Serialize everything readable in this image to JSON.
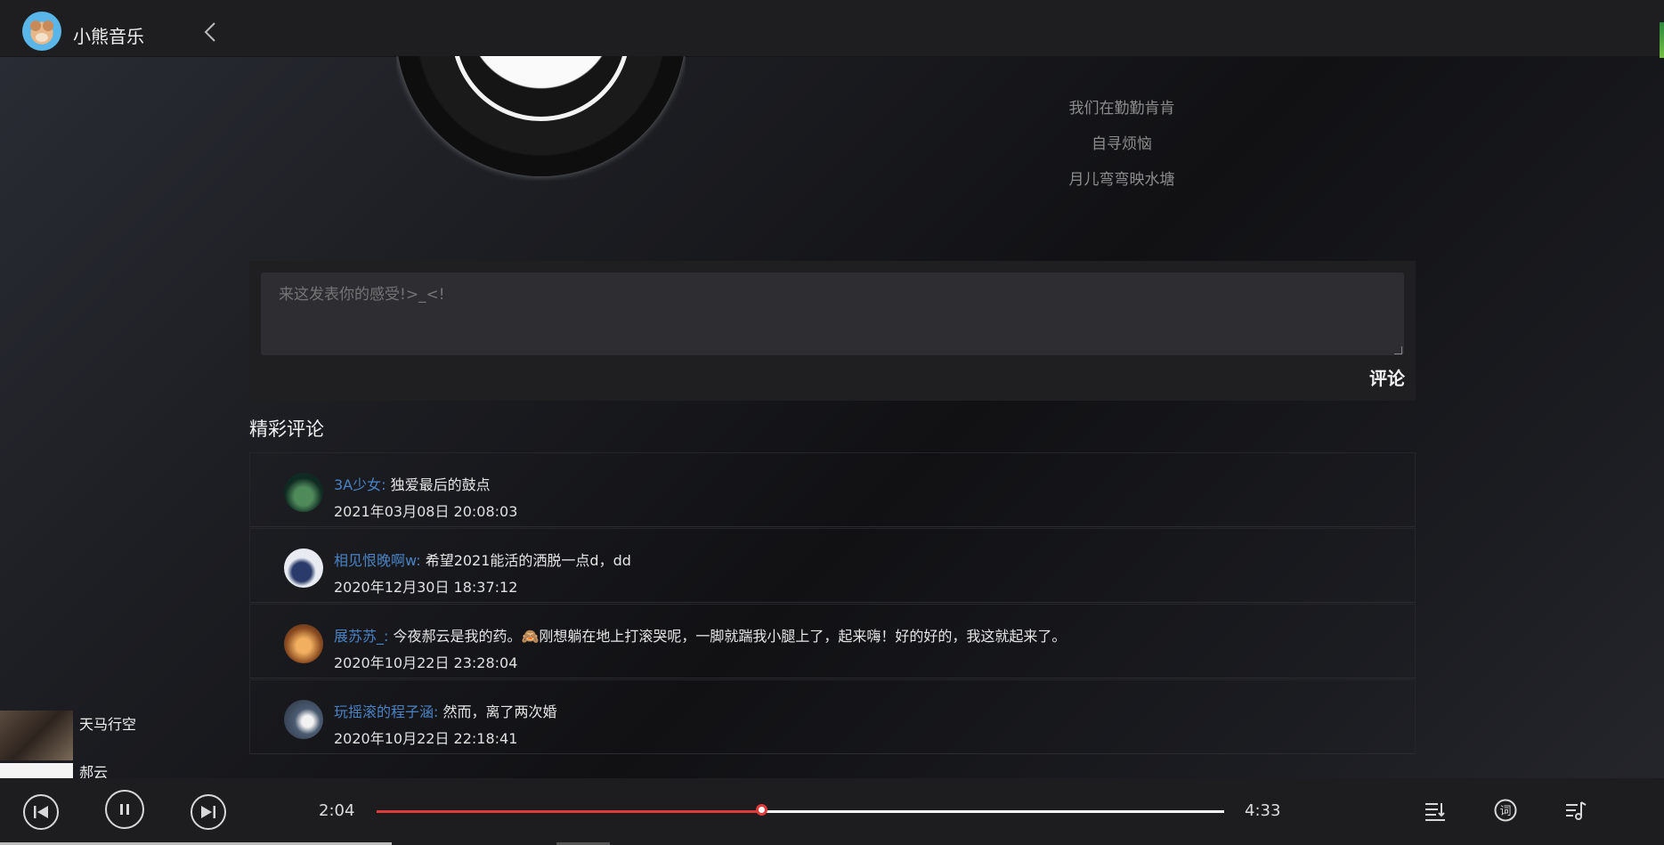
{
  "app": {
    "title": "小熊音乐"
  },
  "lyrics": [
    "我们在勤勤肯肯",
    "自寻烦恼",
    "月儿弯弯映水塘"
  ],
  "comment_form": {
    "placeholder": "来这发表你的感受!>_<!",
    "submit_label": "评论"
  },
  "section_title": "精彩评论",
  "comments": [
    {
      "user": "3A少女:",
      "text": " 独爱最后的鼓点",
      "time": "2021年03月08日 20:08:03",
      "avatar_color": "#1f4a3a"
    },
    {
      "user": "相见恨晚啊w:",
      "text": " 希望2021能活的洒脱一点d，dd",
      "time": "2020年12月30日 18:37:12",
      "avatar_color": "#dfe6f0"
    },
    {
      "user": "展苏苏_:",
      "text": " 今夜郝云是我的药。🙈刚想躺在地上打滚哭呢，一脚就踹我小腿上了，起来嗨！好的好的，我这就起来了。",
      "time": "2020年10月22日 23:28:04",
      "avatar_color": "#c87a3a"
    },
    {
      "user": "玩摇滚的程子涵:",
      "text": " 然而，离了两次婚",
      "time": "2020年10月22日 22:18:41",
      "avatar_color": "#5a6a80"
    }
  ],
  "mini_playlist": {
    "song": "天马行空",
    "artist": "郝云"
  },
  "player": {
    "current_time": "2:04",
    "total_time": "4:33",
    "progress": 0.455,
    "accent": "#e03a3a"
  }
}
